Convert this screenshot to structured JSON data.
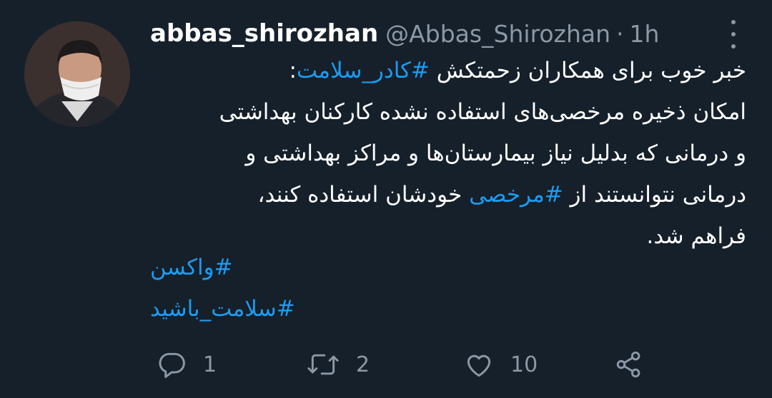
{
  "tweet": {
    "username": "abbas_shirozhan",
    "handle": "@Abbas_Shirozhan",
    "separator": "·",
    "time": "1h",
    "lines": [
      {
        "before": "خبر خوب برای همکاران زحمتکش ",
        "tag": "#کادر_سلامت",
        "after": ":"
      },
      {
        "text": "امکان ذخیره مرخصی‌های استفاده نشده کارکنان بهداشتی"
      },
      {
        "text": "و درمانی که بدلیل نیاز بیمارستان‌ها و مراکز بهداشتی و"
      },
      {
        "before": "درمانی نتوانستند از ",
        "tag": "#مرخصی",
        "after": " خودشان استفاده کنند،"
      },
      {
        "text": "فراهم شد."
      }
    ],
    "hashtags": [
      "#واکسن",
      "#سلامت_باشید"
    ],
    "stats": {
      "replies": "1",
      "retweets": "2",
      "likes": "10"
    }
  },
  "colors": {
    "background": "#15202b",
    "accent": "#1d9bf0",
    "muted": "#8b98a5"
  },
  "icons": {
    "reply": "reply-icon",
    "retweet": "retweet-icon",
    "like": "heart-icon",
    "share": "share-icon",
    "more": "more-vertical-icon"
  }
}
